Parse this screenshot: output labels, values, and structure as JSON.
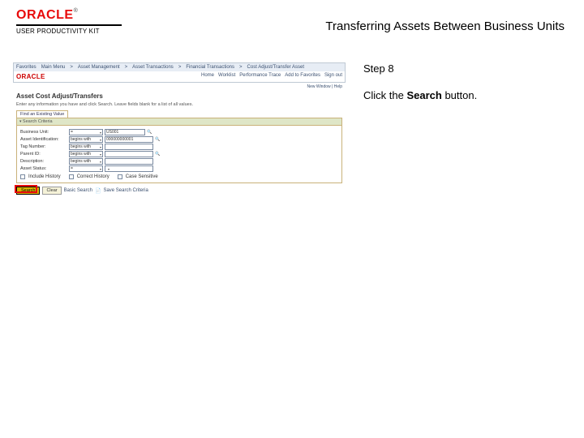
{
  "header": {
    "logo_text": "ORACLE",
    "logo_tm": "®",
    "logo_sub": "USER PRODUCTIVITY KIT",
    "title": "Transferring Assets Between Business Units"
  },
  "instruction": {
    "step_label": "Step 8",
    "text_prefix": "Click the ",
    "text_bold": "Search",
    "text_suffix": " button."
  },
  "ps": {
    "breadcrumb": [
      "Favorites",
      "Main Menu",
      "Asset Management",
      "Asset Transactions",
      "Financial Transactions",
      "Cost Adjust/Transfer Asset"
    ],
    "brand": "ORACLE",
    "top_links": [
      "Home",
      "Worklist",
      "Performance Trace",
      "Add to Favorites",
      "Sign out"
    ],
    "new_window": "New Window | Help",
    "page_title": "Asset Cost Adjust/Transfers",
    "page_desc": "Enter any information you have and click Search. Leave fields blank for a list of all values.",
    "tab": "Find an Existing Value",
    "panel_title": "Search Criteria",
    "fields": {
      "bu_label": "Business Unit:",
      "bu_op": "=",
      "bu_val": "US001",
      "aid_label": "Asset Identification:",
      "aid_op": "begins with",
      "aid_val": "000000000001",
      "tag_label": "Tag Number:",
      "tag_op": "begins with",
      "tag_val": "",
      "parent_label": "Parent ID:",
      "parent_op": "begins with",
      "parent_val": "",
      "desc_label": "Description:",
      "desc_op": "begins with",
      "desc_val": "",
      "status_label": "Asset Status:",
      "status_op": "=",
      "status_val": "",
      "include_label": "Include History",
      "correct_label": "Correct History",
      "case_label": "Case Sensitive"
    },
    "buttons": {
      "search": "Search",
      "clear": "Clear",
      "basic": "Basic Search",
      "save": "Save Search Criteria"
    }
  }
}
